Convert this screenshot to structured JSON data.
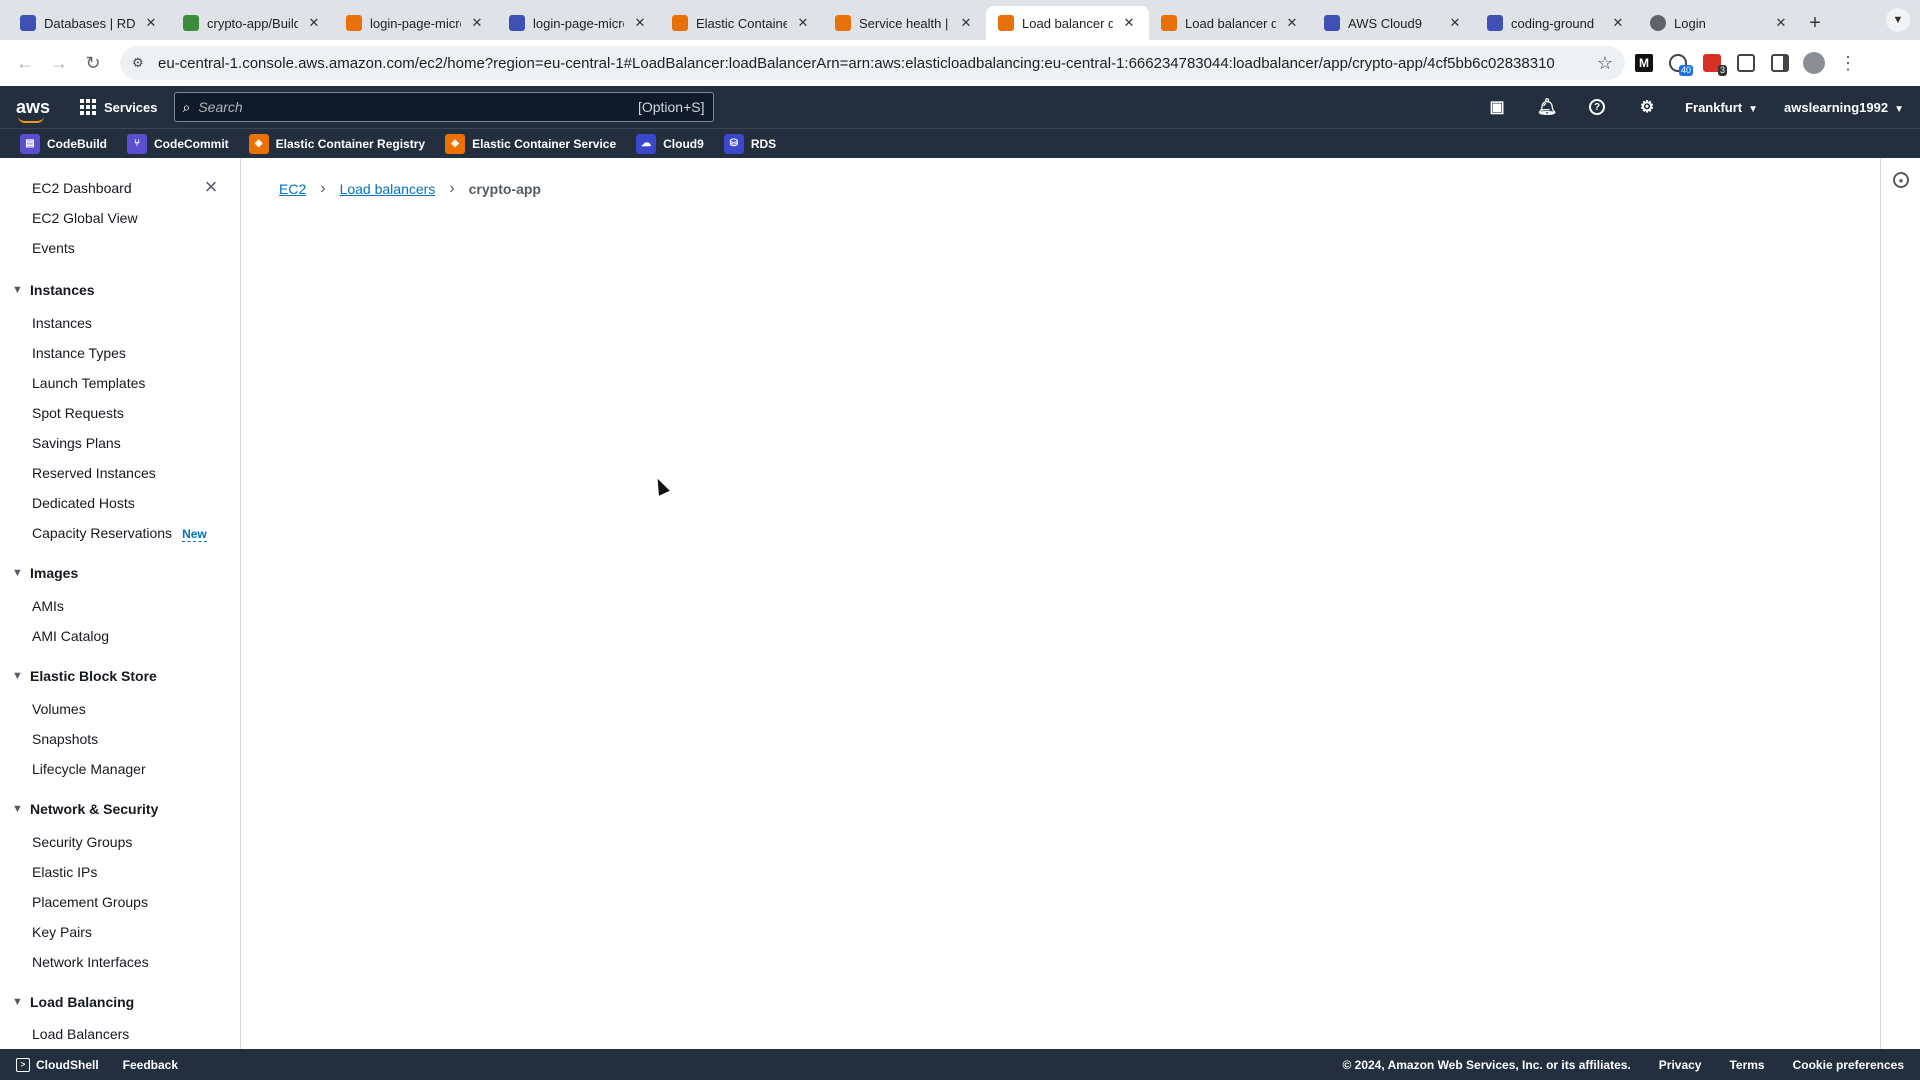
{
  "browser": {
    "tabs": [
      {
        "title": "Databases | RDS",
        "favicon_color": "#3f51b5"
      },
      {
        "title": "crypto-app/Build",
        "favicon_color": "#3c8c3c"
      },
      {
        "title": "login-page-micro",
        "favicon_color": "#e8710a"
      },
      {
        "title": "login-page-micro",
        "favicon_color": "#3f51b5"
      },
      {
        "title": "Elastic Container",
        "favicon_color": "#e8710a"
      },
      {
        "title": "Service health |",
        "favicon_color": "#e8710a"
      },
      {
        "title": "Load balancer d",
        "favicon_color": "#e8710a",
        "active": true
      },
      {
        "title": "Load balancer d",
        "favicon_color": "#e8710a"
      },
      {
        "title": "AWS Cloud9",
        "favicon_color": "#3f51b5"
      },
      {
        "title": "coding-ground",
        "favicon_color": "#3f51b5"
      },
      {
        "title": "Login",
        "favicon_color": "#5f6368"
      }
    ],
    "url": "eu-central-1.console.aws.amazon.com/ec2/home?region=eu-central-1#LoadBalancer:loadBalancerArn=arn:aws:elasticloadbalancing:eu-central-1:666234783044:loadbalancer/app/crypto-app/4cf5bb6c02838310",
    "extensions": {
      "m_label": "M",
      "badge1": "40",
      "badge2": "3"
    }
  },
  "aws_header": {
    "logo": "aws",
    "services_label": "Services",
    "search_placeholder": "Search",
    "search_shortcut": "[Option+S]",
    "region": "Frankfurt",
    "account": "awslearning1992"
  },
  "favorites": [
    {
      "label": "CodeBuild",
      "color": "#5a4fcf"
    },
    {
      "label": "CodeCommit",
      "color": "#5a4fcf"
    },
    {
      "label": "Elastic Container Registry",
      "color": "#ed7100"
    },
    {
      "label": "Elastic Container Service",
      "color": "#ed7100"
    },
    {
      "label": "Cloud9",
      "color": "#3b48cc"
    },
    {
      "label": "RDS",
      "color": "#3b48cc"
    }
  ],
  "sidebar": {
    "top_links": [
      "EC2 Dashboard",
      "EC2 Global View",
      "Events"
    ],
    "sections": [
      {
        "title": "Instances",
        "items": [
          "Instances",
          "Instance Types",
          "Launch Templates",
          "Spot Requests",
          "Savings Plans",
          "Reserved Instances",
          "Dedicated Hosts",
          "Capacity Reservations"
        ]
      },
      {
        "title": "Images",
        "items": [
          "AMIs",
          "AMI Catalog"
        ]
      },
      {
        "title": "Elastic Block Store",
        "items": [
          "Volumes",
          "Snapshots",
          "Lifecycle Manager"
        ]
      },
      {
        "title": "Network & Security",
        "items": [
          "Security Groups",
          "Elastic IPs",
          "Placement Groups",
          "Key Pairs",
          "Network Interfaces"
        ]
      },
      {
        "title": "Load Balancing",
        "items": [
          "Load Balancers"
        ]
      }
    ],
    "new_badge": "New"
  },
  "breadcrumb": {
    "ec2": "EC2",
    "load_balancers": "Load balancers",
    "current": "crypto-app"
  },
  "footer": {
    "cloudshell": "CloudShell",
    "feedback": "Feedback",
    "copyright": "© 2024, Amazon Web Services, Inc. or its affiliates.",
    "privacy": "Privacy",
    "terms": "Terms",
    "cookies": "Cookie preferences"
  }
}
